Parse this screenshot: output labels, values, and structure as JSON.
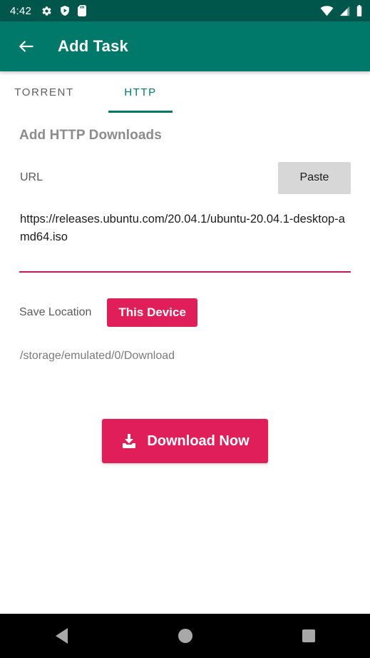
{
  "status_bar": {
    "time": "4:42",
    "left_icons": [
      "gear-icon",
      "shield-play-icon",
      "sd-card-icon"
    ],
    "right_icons": [
      "wifi-icon",
      "cell-signal-icon",
      "battery-icon"
    ],
    "background_color": "#00564b"
  },
  "app_bar": {
    "back_icon": "arrow-left-icon",
    "title": "Add Task",
    "background_color": "#00796b"
  },
  "tabs": [
    {
      "label": "TORRENT",
      "selected": false
    },
    {
      "label": "HTTP",
      "selected": true
    }
  ],
  "tab_accent_color": "#00796b",
  "form": {
    "section_title": "Add HTTP Downloads",
    "url_label": "URL",
    "paste_label": "Paste",
    "url_value": "https://releases.ubuntu.com/20.04.1/ubuntu-20.04.1-desktop-amd64.iso",
    "url_placeholder": "URL",
    "url_underline_color": "#c2185b",
    "save_location_label": "Save Location",
    "save_location_value": "This Device",
    "save_path": "/storage/emulated/0/Download",
    "download_button_label": "Download Now",
    "download_icon": "download-tray-icon",
    "accent_pink": "#e01e5a"
  },
  "nav_bar": {
    "back": "back-triangle-icon",
    "home": "home-circle-icon",
    "recents": "recents-square-icon"
  }
}
